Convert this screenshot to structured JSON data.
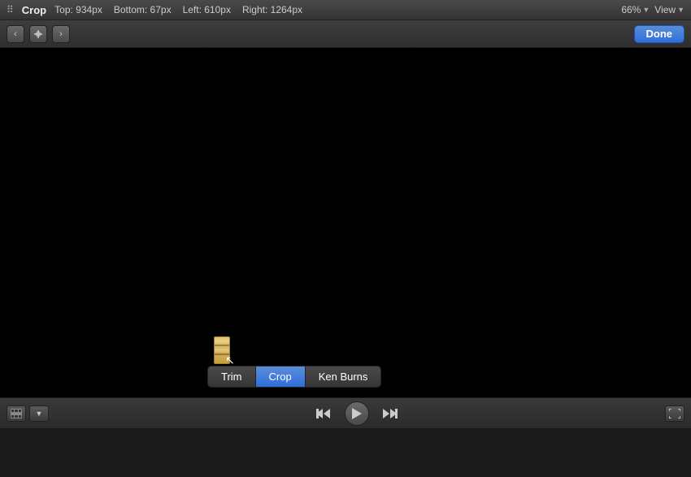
{
  "titlebar": {
    "app_icon": "grid-icon",
    "mode_label": "Crop",
    "coords": {
      "top": "Top: 934px",
      "bottom": "Bottom: 67px",
      "left": "Left: 610px",
      "right": "Right: 1264px"
    },
    "zoom": "66%",
    "zoom_arrow": "▼",
    "view_label": "View",
    "view_arrow": "▼"
  },
  "toolbar": {
    "prev_label": "‹",
    "center_label": "✛",
    "next_label": "›",
    "done_label": "Done"
  },
  "popup": {
    "buttons": [
      {
        "label": "Trim",
        "active": false
      },
      {
        "label": "Crop",
        "active": true
      },
      {
        "label": "Ken Burns",
        "active": false
      }
    ]
  },
  "bottom": {
    "clip_icon": "film-icon",
    "dropdown_arrow": "▼",
    "rewind_label": "⏮",
    "play_label": "▶",
    "fastforward_label": "⏭",
    "fullscreen_label": "⤢"
  }
}
